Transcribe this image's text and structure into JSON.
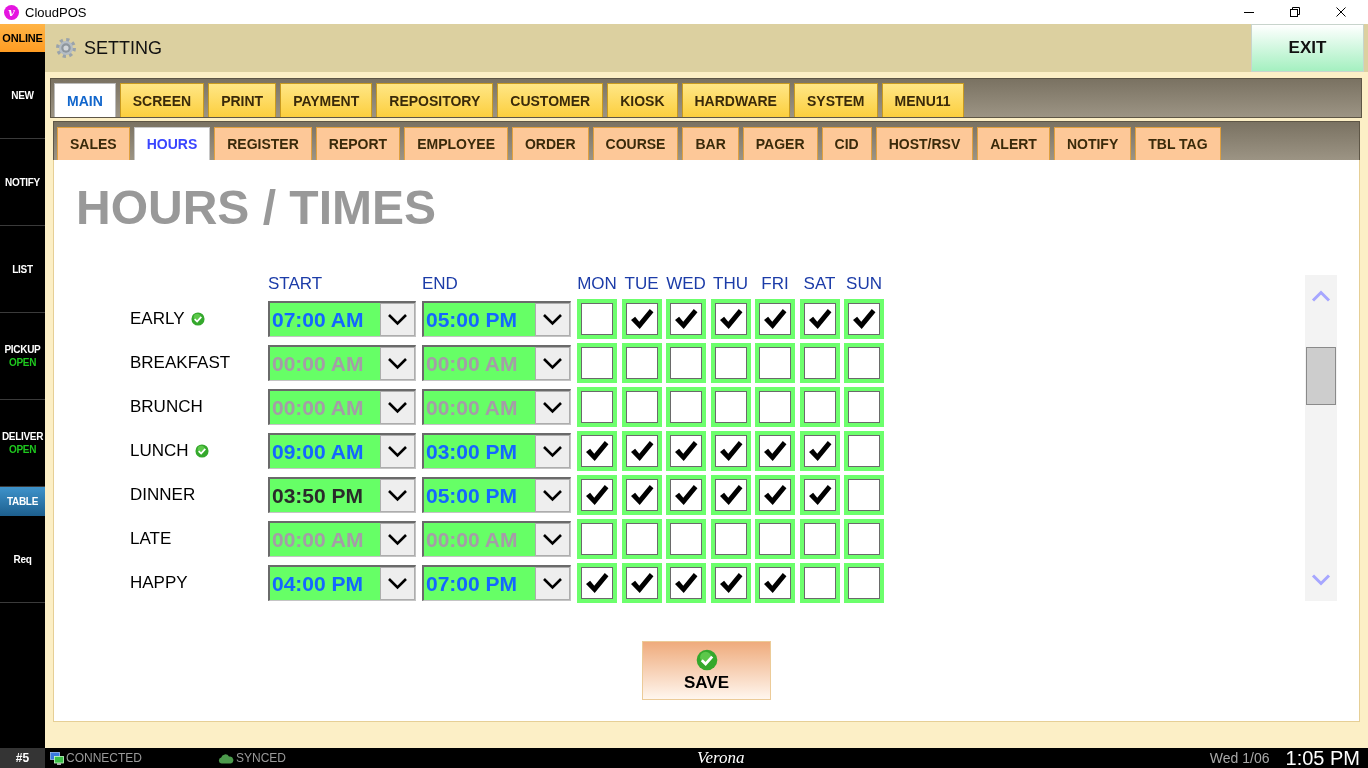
{
  "window": {
    "title": "CloudPOS",
    "logo": "v"
  },
  "sidebar": {
    "items": [
      {
        "label": "ONLINE",
        "kind": "status",
        "selected": false
      },
      {
        "label": "NEW",
        "kind": "nav",
        "selected": false
      },
      {
        "label": "NOTIFY",
        "kind": "nav",
        "selected": false
      },
      {
        "label": "LIST",
        "kind": "nav",
        "selected": false
      },
      {
        "label": "PICKUP",
        "sub": "OPEN",
        "kind": "nav",
        "selected": false
      },
      {
        "label": "DELIVER",
        "sub": "OPEN",
        "kind": "nav",
        "selected": false
      },
      {
        "label": "TABLE",
        "kind": "mode",
        "selected": true
      },
      {
        "label": "Req",
        "kind": "nav",
        "selected": false
      }
    ]
  },
  "header": {
    "title": "SETTING",
    "exit_button": "EXIT"
  },
  "main_tabs": [
    {
      "label": "MAIN",
      "selected": true
    },
    {
      "label": "SCREEN",
      "selected": false
    },
    {
      "label": "PRINT",
      "selected": false
    },
    {
      "label": "PAYMENT",
      "selected": false
    },
    {
      "label": "REPOSITORY",
      "selected": false
    },
    {
      "label": "CUSTOMER",
      "selected": false
    },
    {
      "label": "KIOSK",
      "selected": false
    },
    {
      "label": "HARDWARE",
      "selected": false
    },
    {
      "label": "SYSTEM",
      "selected": false
    },
    {
      "label": "MENU11",
      "selected": false
    }
  ],
  "sub_tabs": [
    {
      "label": "SALES",
      "selected": false
    },
    {
      "label": "HOURS",
      "selected": true
    },
    {
      "label": "REGISTER",
      "selected": false
    },
    {
      "label": "REPORT",
      "selected": false
    },
    {
      "label": "EMPLOYEE",
      "selected": false
    },
    {
      "label": "ORDER",
      "selected": false
    },
    {
      "label": "COURSE",
      "selected": false
    },
    {
      "label": "BAR",
      "selected": false
    },
    {
      "label": "PAGER",
      "selected": false
    },
    {
      "label": "CID",
      "selected": false
    },
    {
      "label": "HOST/RSV",
      "selected": false
    },
    {
      "label": "ALERT",
      "selected": false
    },
    {
      "label": "NOTIFY",
      "selected": false
    },
    {
      "label": "TBL TAG",
      "selected": false
    }
  ],
  "heading": "HOURS / TIMES",
  "schedule": {
    "columns": {
      "start": "START",
      "end": "END",
      "days": [
        "MON",
        "TUE",
        "WED",
        "THU",
        "FRI",
        "SAT",
        "SUN"
      ]
    },
    "rows": [
      {
        "name": "EARLY",
        "active": true,
        "start": {
          "value": "07:00 AM",
          "disabled": false,
          "focused": false
        },
        "end": {
          "value": "05:00 PM",
          "disabled": false,
          "focused": false
        },
        "days": [
          {
            "checked": false
          },
          {
            "checked": true
          },
          {
            "checked": true
          },
          {
            "checked": true
          },
          {
            "checked": true
          },
          {
            "checked": true
          },
          {
            "checked": true
          }
        ]
      },
      {
        "name": "BREAKFAST",
        "active": false,
        "start": {
          "value": "00:00 AM",
          "disabled": true,
          "focused": false
        },
        "end": {
          "value": "00:00 AM",
          "disabled": true,
          "focused": false
        },
        "days": [
          {
            "checked": false
          },
          {
            "checked": false
          },
          {
            "checked": false
          },
          {
            "checked": false
          },
          {
            "checked": false
          },
          {
            "checked": false
          },
          {
            "checked": false
          }
        ]
      },
      {
        "name": "BRUNCH",
        "active": false,
        "start": {
          "value": "00:00 AM",
          "disabled": true,
          "focused": false
        },
        "end": {
          "value": "00:00 AM",
          "disabled": true,
          "focused": false
        },
        "days": [
          {
            "checked": false
          },
          {
            "checked": false
          },
          {
            "checked": false
          },
          {
            "checked": false
          },
          {
            "checked": false
          },
          {
            "checked": false
          },
          {
            "checked": false
          }
        ]
      },
      {
        "name": "LUNCH",
        "active": true,
        "start": {
          "value": "09:00 AM",
          "disabled": false,
          "focused": false
        },
        "end": {
          "value": "03:00 PM",
          "disabled": false,
          "focused": false
        },
        "days": [
          {
            "checked": true
          },
          {
            "checked": true
          },
          {
            "checked": true
          },
          {
            "checked": true
          },
          {
            "checked": true
          },
          {
            "checked": true
          },
          {
            "checked": false
          }
        ]
      },
      {
        "name": "DINNER",
        "active": false,
        "start": {
          "value": "03:50 PM",
          "disabled": false,
          "focused": true
        },
        "end": {
          "value": "05:00 PM",
          "disabled": false,
          "focused": false
        },
        "days": [
          {
            "checked": true
          },
          {
            "checked": true
          },
          {
            "checked": true
          },
          {
            "checked": true
          },
          {
            "checked": true
          },
          {
            "checked": true
          },
          {
            "checked": false
          }
        ]
      },
      {
        "name": "LATE",
        "active": false,
        "start": {
          "value": "00:00 AM",
          "disabled": true,
          "focused": false
        },
        "end": {
          "value": "00:00 AM",
          "disabled": true,
          "focused": false
        },
        "days": [
          {
            "checked": false
          },
          {
            "checked": false
          },
          {
            "checked": false
          },
          {
            "checked": false
          },
          {
            "checked": false
          },
          {
            "checked": false
          },
          {
            "checked": false
          }
        ]
      },
      {
        "name": "HAPPY",
        "active": false,
        "start": {
          "value": "04:00 PM",
          "disabled": false,
          "focused": false
        },
        "end": {
          "value": "07:00 PM",
          "disabled": false,
          "focused": false
        },
        "days": [
          {
            "checked": true
          },
          {
            "checked": true
          },
          {
            "checked": true
          },
          {
            "checked": true
          },
          {
            "checked": true
          },
          {
            "checked": false
          },
          {
            "checked": false
          }
        ]
      }
    ]
  },
  "save_button": "SAVE",
  "status_bar": {
    "terminal": "#5",
    "connection": "CONNECTED",
    "sync": "SYNCED",
    "location": "Verona",
    "date": "Wed 1/06",
    "time": "1:05 PM"
  }
}
